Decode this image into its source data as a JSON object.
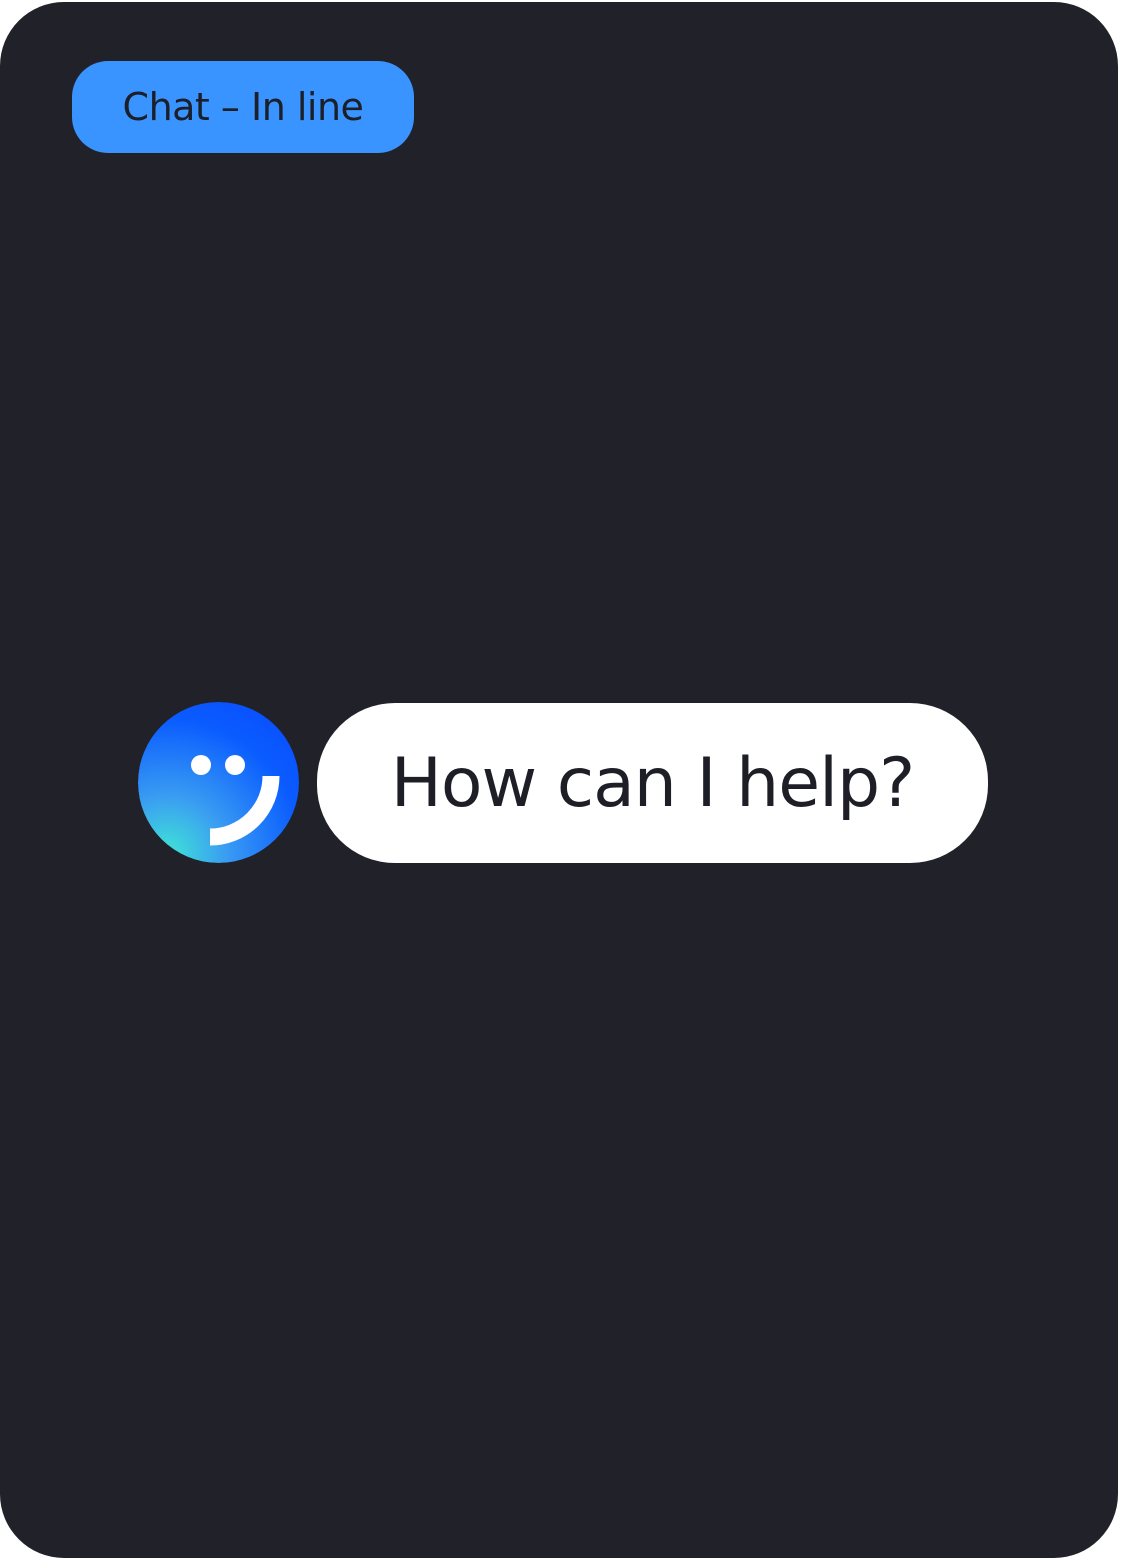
{
  "tag": {
    "label": "Chat – In line",
    "color": "#3a94ff"
  },
  "chat": {
    "avatar_icon": "smiley-icon",
    "message": "How can I help?"
  },
  "colors": {
    "background": "#21212a",
    "bubble": "#ffffff",
    "avatar_gradient_start": "#0a5cff",
    "avatar_gradient_end": "#3fe6d6"
  }
}
